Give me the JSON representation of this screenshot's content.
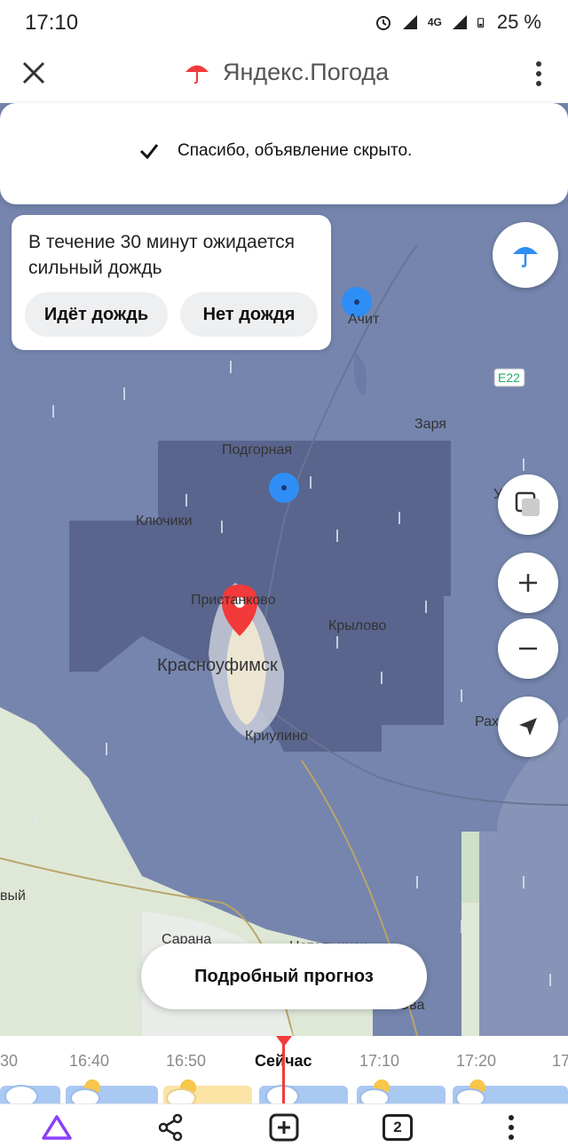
{
  "status_bar": {
    "time": "17:10",
    "battery": "25 %",
    "network": "4G"
  },
  "app_bar": {
    "title": "Яндекс.Погода"
  },
  "toast": {
    "message": "Спасибо, объявление скрыто."
  },
  "rain_card": {
    "text": "В течение 30 минут ожидается сильный дождь",
    "button_raining": "Идёт дождь",
    "button_no_rain": "Нет дождя"
  },
  "map": {
    "labels": {
      "achit": "Ачит",
      "e22": "E22",
      "zarya": "Заря",
      "podgornaya": "Подгорная",
      "klyuchiki": "Ключики",
      "pristankovo": "Пристанково",
      "krylovo": "Крылово",
      "krasnoufimsk": "Красноуфимск",
      "kriulino": "Криулино",
      "rakh": "Рах",
      "vyi": "вый",
      "sarana": "Сарана",
      "natalinsk": "Натальинск",
      "yuva": "Юва",
      "u": "У"
    }
  },
  "forecast_button": {
    "label": "Подробный прогноз"
  },
  "timeline": {
    "labels": [
      "30",
      "16:40",
      "16:50",
      "Сейчас",
      "17:10",
      "17:20",
      "17"
    ]
  },
  "colors": {
    "map_rain": "#7585ad",
    "map_heavy": "#56628a",
    "accent_blue": "#2e8ef5",
    "pin_red": "#f23a3a"
  }
}
